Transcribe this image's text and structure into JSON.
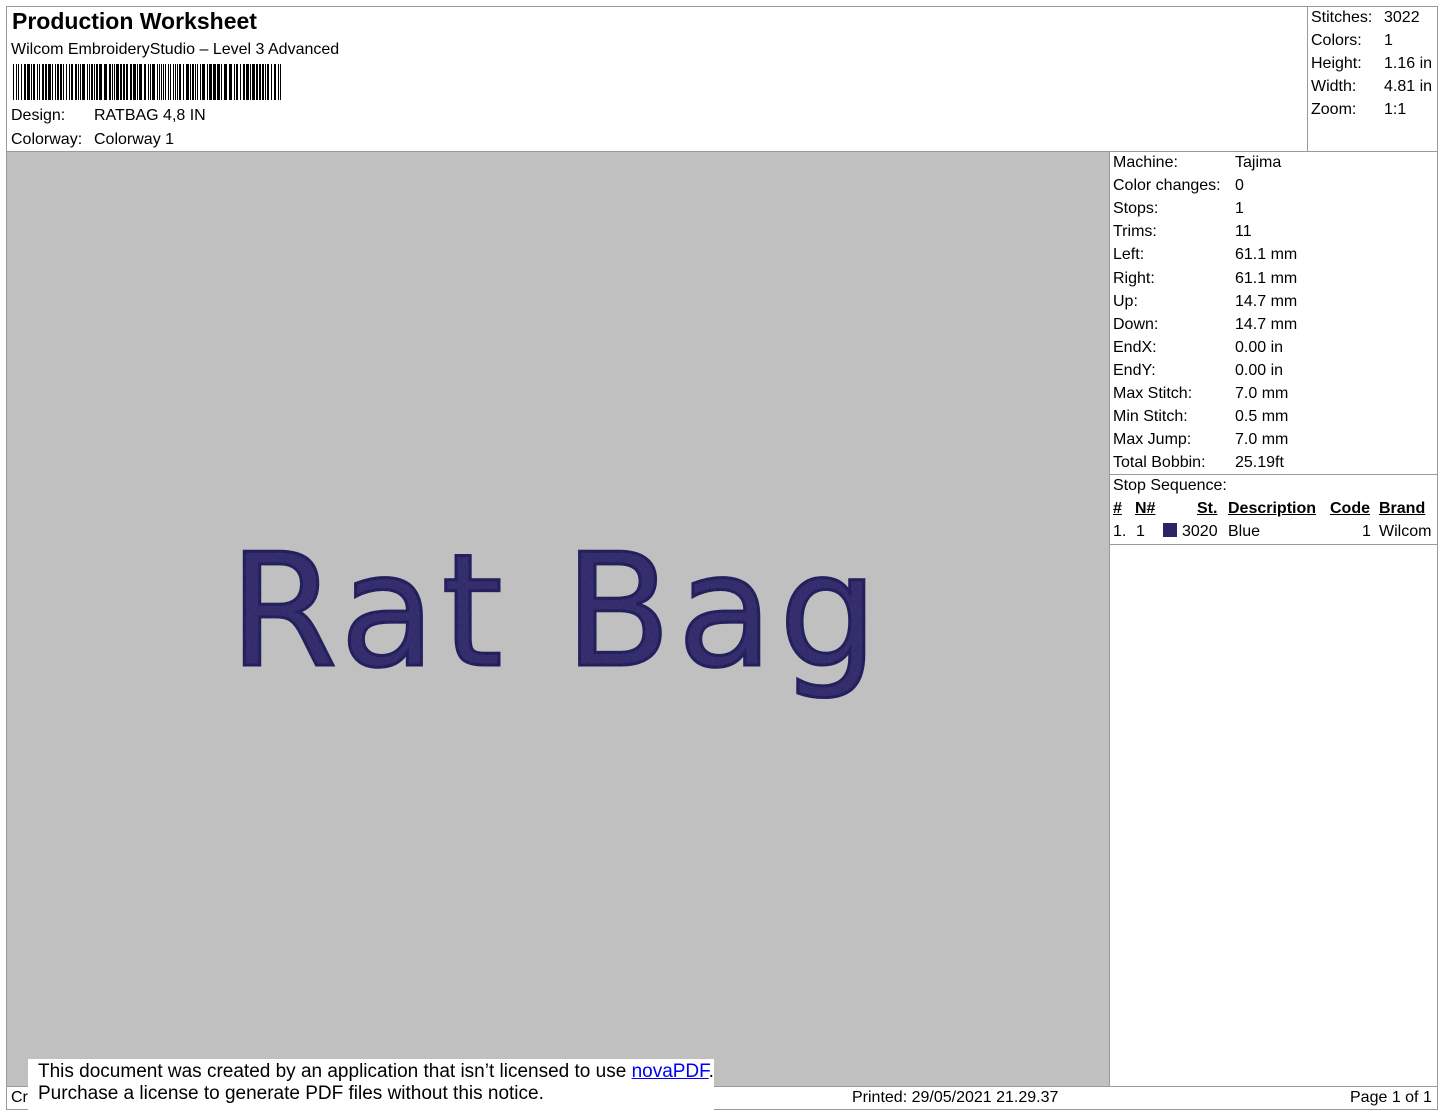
{
  "header": {
    "title": "Production Worksheet",
    "subtitle": "Wilcom EmbroideryStudio – Level 3 Advanced",
    "design_label": "Design:",
    "design_value": "RATBAG 4,8 IN",
    "colorway_label": "Colorway:",
    "colorway_value": "Colorway 1"
  },
  "summary": {
    "stitches_label": "Stitches:",
    "stitches_value": "3022",
    "colors_label": "Colors:",
    "colors_value": "1",
    "height_label": "Height:",
    "height_value": "1.16 in",
    "width_label": "Width:",
    "width_value": "4.81 in",
    "zoom_label": "Zoom:",
    "zoom_value": "1:1"
  },
  "machine_info": [
    {
      "label": "Machine:",
      "value": "Tajima"
    },
    {
      "label": "Color changes:",
      "value": "0"
    },
    {
      "label": "Stops:",
      "value": "1"
    },
    {
      "label": "Trims:",
      "value": "11"
    },
    {
      "label": "Left:",
      "value": "61.1 mm"
    },
    {
      "label": "Right:",
      "value": "61.1 mm"
    },
    {
      "label": "Up:",
      "value": "14.7 mm"
    },
    {
      "label": "Down:",
      "value": "14.7 mm"
    },
    {
      "label": "EndX:",
      "value": "0.00 in"
    },
    {
      "label": "EndY:",
      "value": "0.00 in"
    },
    {
      "label": "Max Stitch:",
      "value": "7.0 mm"
    },
    {
      "label": "Min Stitch:",
      "value": "0.5 mm"
    },
    {
      "label": "Max Jump:",
      "value": "7.0 mm"
    },
    {
      "label": "Total Bobbin:",
      "value": "25.19ft"
    }
  ],
  "stop_sequence": {
    "title": "Stop Sequence:",
    "columns": [
      "#",
      "N#",
      "St.",
      "Description",
      "Code",
      "Brand"
    ],
    "rows": [
      {
        "index": "1.",
        "n": "1",
        "color": "#2a2566",
        "st": "3020",
        "description": "Blue",
        "code": "1",
        "brand": "Wilcom"
      }
    ]
  },
  "design_preview": {
    "text": "Rat Bag",
    "thread_color": "#3b3478",
    "background_color": "#c0c0c0"
  },
  "footer": {
    "left_stub": "Cr",
    "printed": "Printed: 29/05/2021 21.29.37",
    "page": "Page 1 of 1"
  },
  "notice": {
    "line1_prefix": "This document was created by an application that isn’t licensed to use ",
    "link": "novaPDF",
    "line1_suffix": ".",
    "line2": "Purchase a license to generate PDF files without this notice."
  }
}
